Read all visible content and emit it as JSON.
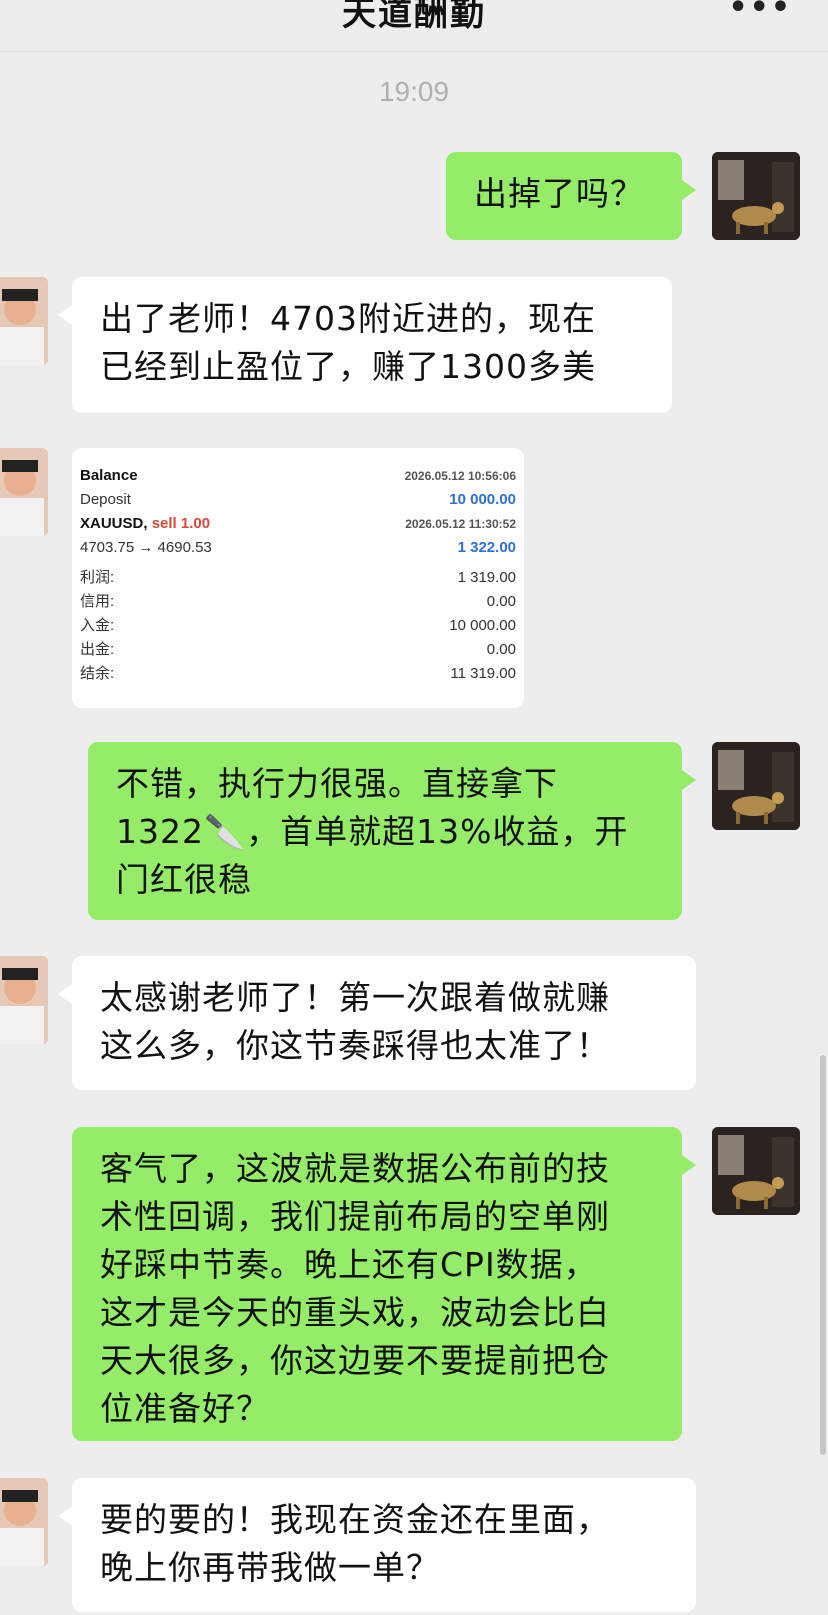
{
  "header": {
    "title": "天道酬勤",
    "more_label": "•••"
  },
  "timestamp": "19:09",
  "messages": [
    {
      "from": "me",
      "lines": [
        "出掉了吗？"
      ]
    },
    {
      "from": "friend",
      "lines": [
        "出了老师！4703附近进的，现在",
        "已经到止盈位了，赚了1300多美"
      ]
    },
    {
      "from": "me",
      "lines": [
        "不错，执行力很强。直接拿下",
        "1322🔪，首单就超13%收益，开",
        "门红很稳"
      ]
    },
    {
      "from": "friend",
      "lines": [
        "太感谢老师了！第一次跟着做就赚",
        "这么多，你这节奏踩得也太准了！"
      ]
    },
    {
      "from": "me",
      "lines": [
        "客气了，这波就是数据公布前的技",
        "术性回调，我们提前布局的空单刚",
        "好踩中节奏。晚上还有CPI数据，",
        "这才是今天的重头戏，波动会比白",
        "天大很多，你这边要不要提前把仓",
        "位准备好？"
      ]
    },
    {
      "from": "friend",
      "lines": [
        "要的要的！我现在资金还在里面，",
        "晚上你再带我做一单？"
      ]
    }
  ],
  "trade_card": {
    "balance_label": "Balance",
    "balance_time": "2026.05.12 10:56:06",
    "deposit_label": "Deposit",
    "deposit_value": "10 000.00",
    "symbol": "XAUUSD,",
    "side": "sell 1.00",
    "trade_time": "2026.05.12 11:30:52",
    "prices": "4703.75 → 4690.53",
    "trade_profit": "1 322.00",
    "summary": [
      {
        "label": "利润:",
        "value": "1 319.00"
      },
      {
        "label": "信用:",
        "value": "0.00"
      },
      {
        "label": "入金:",
        "value": "10 000.00"
      },
      {
        "label": "出金:",
        "value": "0.00"
      },
      {
        "label": "结余:",
        "value": "11 319.00"
      }
    ]
  },
  "colors": {
    "my_bubble": "#95ec69",
    "their_bubble": "#ffffff",
    "background": "#ededed"
  }
}
